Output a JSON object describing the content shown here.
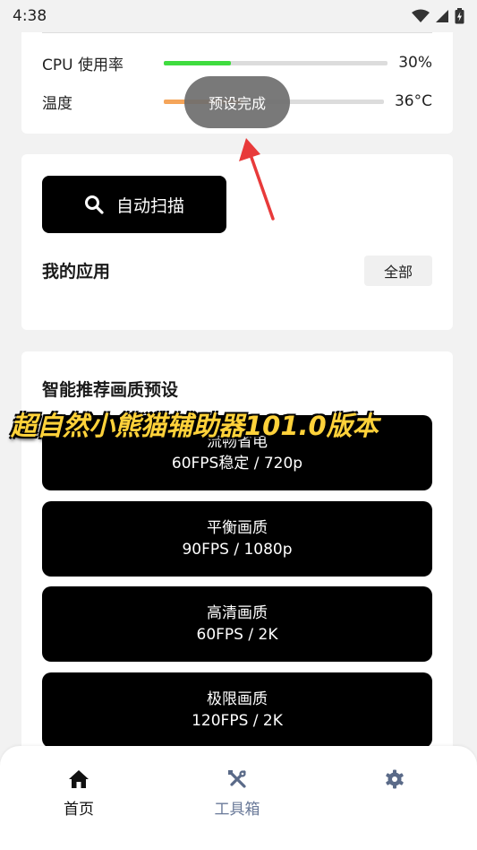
{
  "status_bar": {
    "time": "4:38"
  },
  "metrics": [
    {
      "label": "CPU 使用率",
      "value": "30%",
      "level": 0.3,
      "color": "#3fdc3f"
    },
    {
      "label": "温度",
      "value": "36°C",
      "level": 0.36,
      "color": "#f5a55a"
    }
  ],
  "toast": {
    "text": "预设完成"
  },
  "apps_card": {
    "scan_button": "自动扫描",
    "title": "我的应用",
    "filter_button": "全部"
  },
  "presets_card": {
    "title": "智能推荐画质预设",
    "presets": [
      {
        "name": "流畅省电",
        "spec": "60FPS稳定 / 720p"
      },
      {
        "name": "平衡画质",
        "spec": "90FPS / 1080p"
      },
      {
        "name": "高清画质",
        "spec": "60FPS / 2K"
      },
      {
        "name": "极限画质",
        "spec": "120FPS / 2K"
      }
    ]
  },
  "watermark": {
    "text": "超自然小熊猫辅助器101.0版本"
  },
  "bottom_nav": {
    "items": [
      {
        "label": "首页",
        "icon": "home-icon",
        "active": true
      },
      {
        "label": "工具箱",
        "icon": "tools-icon",
        "active": false
      },
      {
        "label": "",
        "icon": "gear-icon",
        "active": false
      }
    ]
  },
  "colors": {
    "accent_active": "#111111",
    "nav_inactive": "#6a7a99"
  }
}
